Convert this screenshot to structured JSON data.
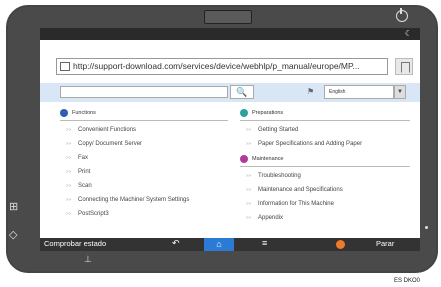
{
  "browser": {
    "url": "http://support-download.com/services/device/webhlp/p_manual/europe/MP...",
    "search_button_icon": "search-icon",
    "language": "English"
  },
  "left_column": {
    "heading": "Functions",
    "bullet_color": "#2f5fb3",
    "links": [
      "Convenient Functions",
      "Copy/ Document Server",
      "Fax",
      "Print",
      "Scan",
      "Connecting the Machine/ System Settings",
      "PostScript3"
    ]
  },
  "right_column": {
    "sections": [
      {
        "heading": "Preparations",
        "bullet_color": "#2fa0a0",
        "links": [
          "Getting Started",
          "Paper Specifications and Adding Paper"
        ]
      },
      {
        "heading": "Maintenance",
        "bullet_color": "#b03a9a",
        "links": [
          "Troubleshooting",
          "Maintenance and Specifications",
          "Information for This Machine",
          "Appendix"
        ]
      }
    ]
  },
  "navbar": {
    "status_label": "Comprobar estado",
    "stop_label": "Parar",
    "home_color": "#2a7ad6",
    "stop_color": "#f07a2a"
  },
  "figure_code": "ES DKO0"
}
